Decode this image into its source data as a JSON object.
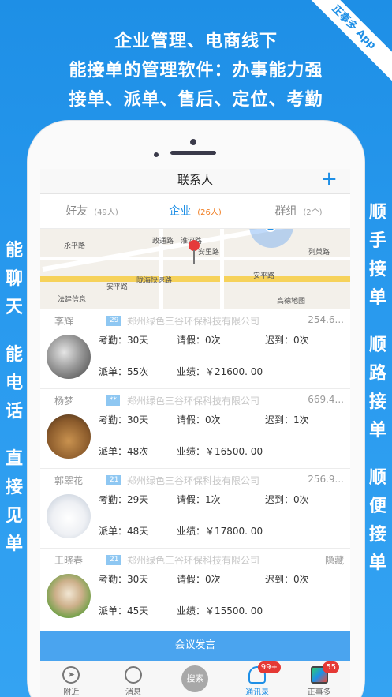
{
  "headline": [
    "企业管理、电商线下",
    "能接单的管理软件：办事能力强",
    "接单、派单、售后、定位、考勤"
  ],
  "ribbon": "正事多 App",
  "left_features": [
    "能聊天",
    "能电话",
    "直接见单"
  ],
  "right_features": [
    "顺手接单",
    "顺路接单",
    "顺便接单"
  ],
  "nav": {
    "title": "联系人",
    "add_icon": "+"
  },
  "tabs": [
    {
      "label": "好友",
      "count": "(49人)"
    },
    {
      "label": "企业",
      "count": "(26人)"
    },
    {
      "label": "群组",
      "count": "(2个)"
    }
  ],
  "map": {
    "labels": [
      "永平路",
      "安平路",
      "陇海快速路",
      "安平路",
      "法建信息",
      "高德地图",
      "政通路",
      "淮河路",
      "列巢路",
      "安里路"
    ]
  },
  "contacts": [
    {
      "ghost_name": "李辉",
      "badge": "29",
      "company": "郑州绿色三谷环保科技有限公司",
      "distance": "254.6...",
      "attendance": "考勤：30天",
      "leave": "请假：0次",
      "late": "迟到：0次",
      "dispatch": "派单：55次",
      "performance": "业绩：￥21600. 00"
    },
    {
      "ghost_name": "杨梦",
      "badge": "**",
      "company": "郑州绿色三谷环保科技有限公司",
      "distance": "669.4...",
      "attendance": "考勤：30天",
      "leave": "请假：0次",
      "late": "迟到：1次",
      "dispatch": "派单：48次",
      "performance": "业绩：￥16500. 00"
    },
    {
      "ghost_name": "郭翠花",
      "badge": "21",
      "company": "郑州绿色三谷环保科技有限公司",
      "distance": "256.9...",
      "attendance": "考勤：29天",
      "leave": "请假：1次",
      "late": "迟到：0次",
      "dispatch": "派单：48天",
      "performance": "业绩：￥17800. 00"
    },
    {
      "ghost_name": "王晓春",
      "badge": "21",
      "company": "郑州绿色三谷环保科技有限公司",
      "distance": "隐藏",
      "attendance": "考勤：30天",
      "leave": "请假：0次",
      "late": "迟到：0次",
      "dispatch": "派单：45天",
      "performance": "业绩：￥15500. 00"
    }
  ],
  "meeting_button": "会议发言",
  "bottom_bar": [
    {
      "label": "附近",
      "icon": "compass-icon"
    },
    {
      "label": "消息",
      "icon": "chat-bubble-icon"
    },
    {
      "label": "搜索",
      "icon": "search-icon"
    },
    {
      "label": "通讯录",
      "icon": "contacts-icon",
      "badge": "99+"
    },
    {
      "label": "正事多",
      "icon": "app-icon",
      "badge": "55"
    }
  ]
}
